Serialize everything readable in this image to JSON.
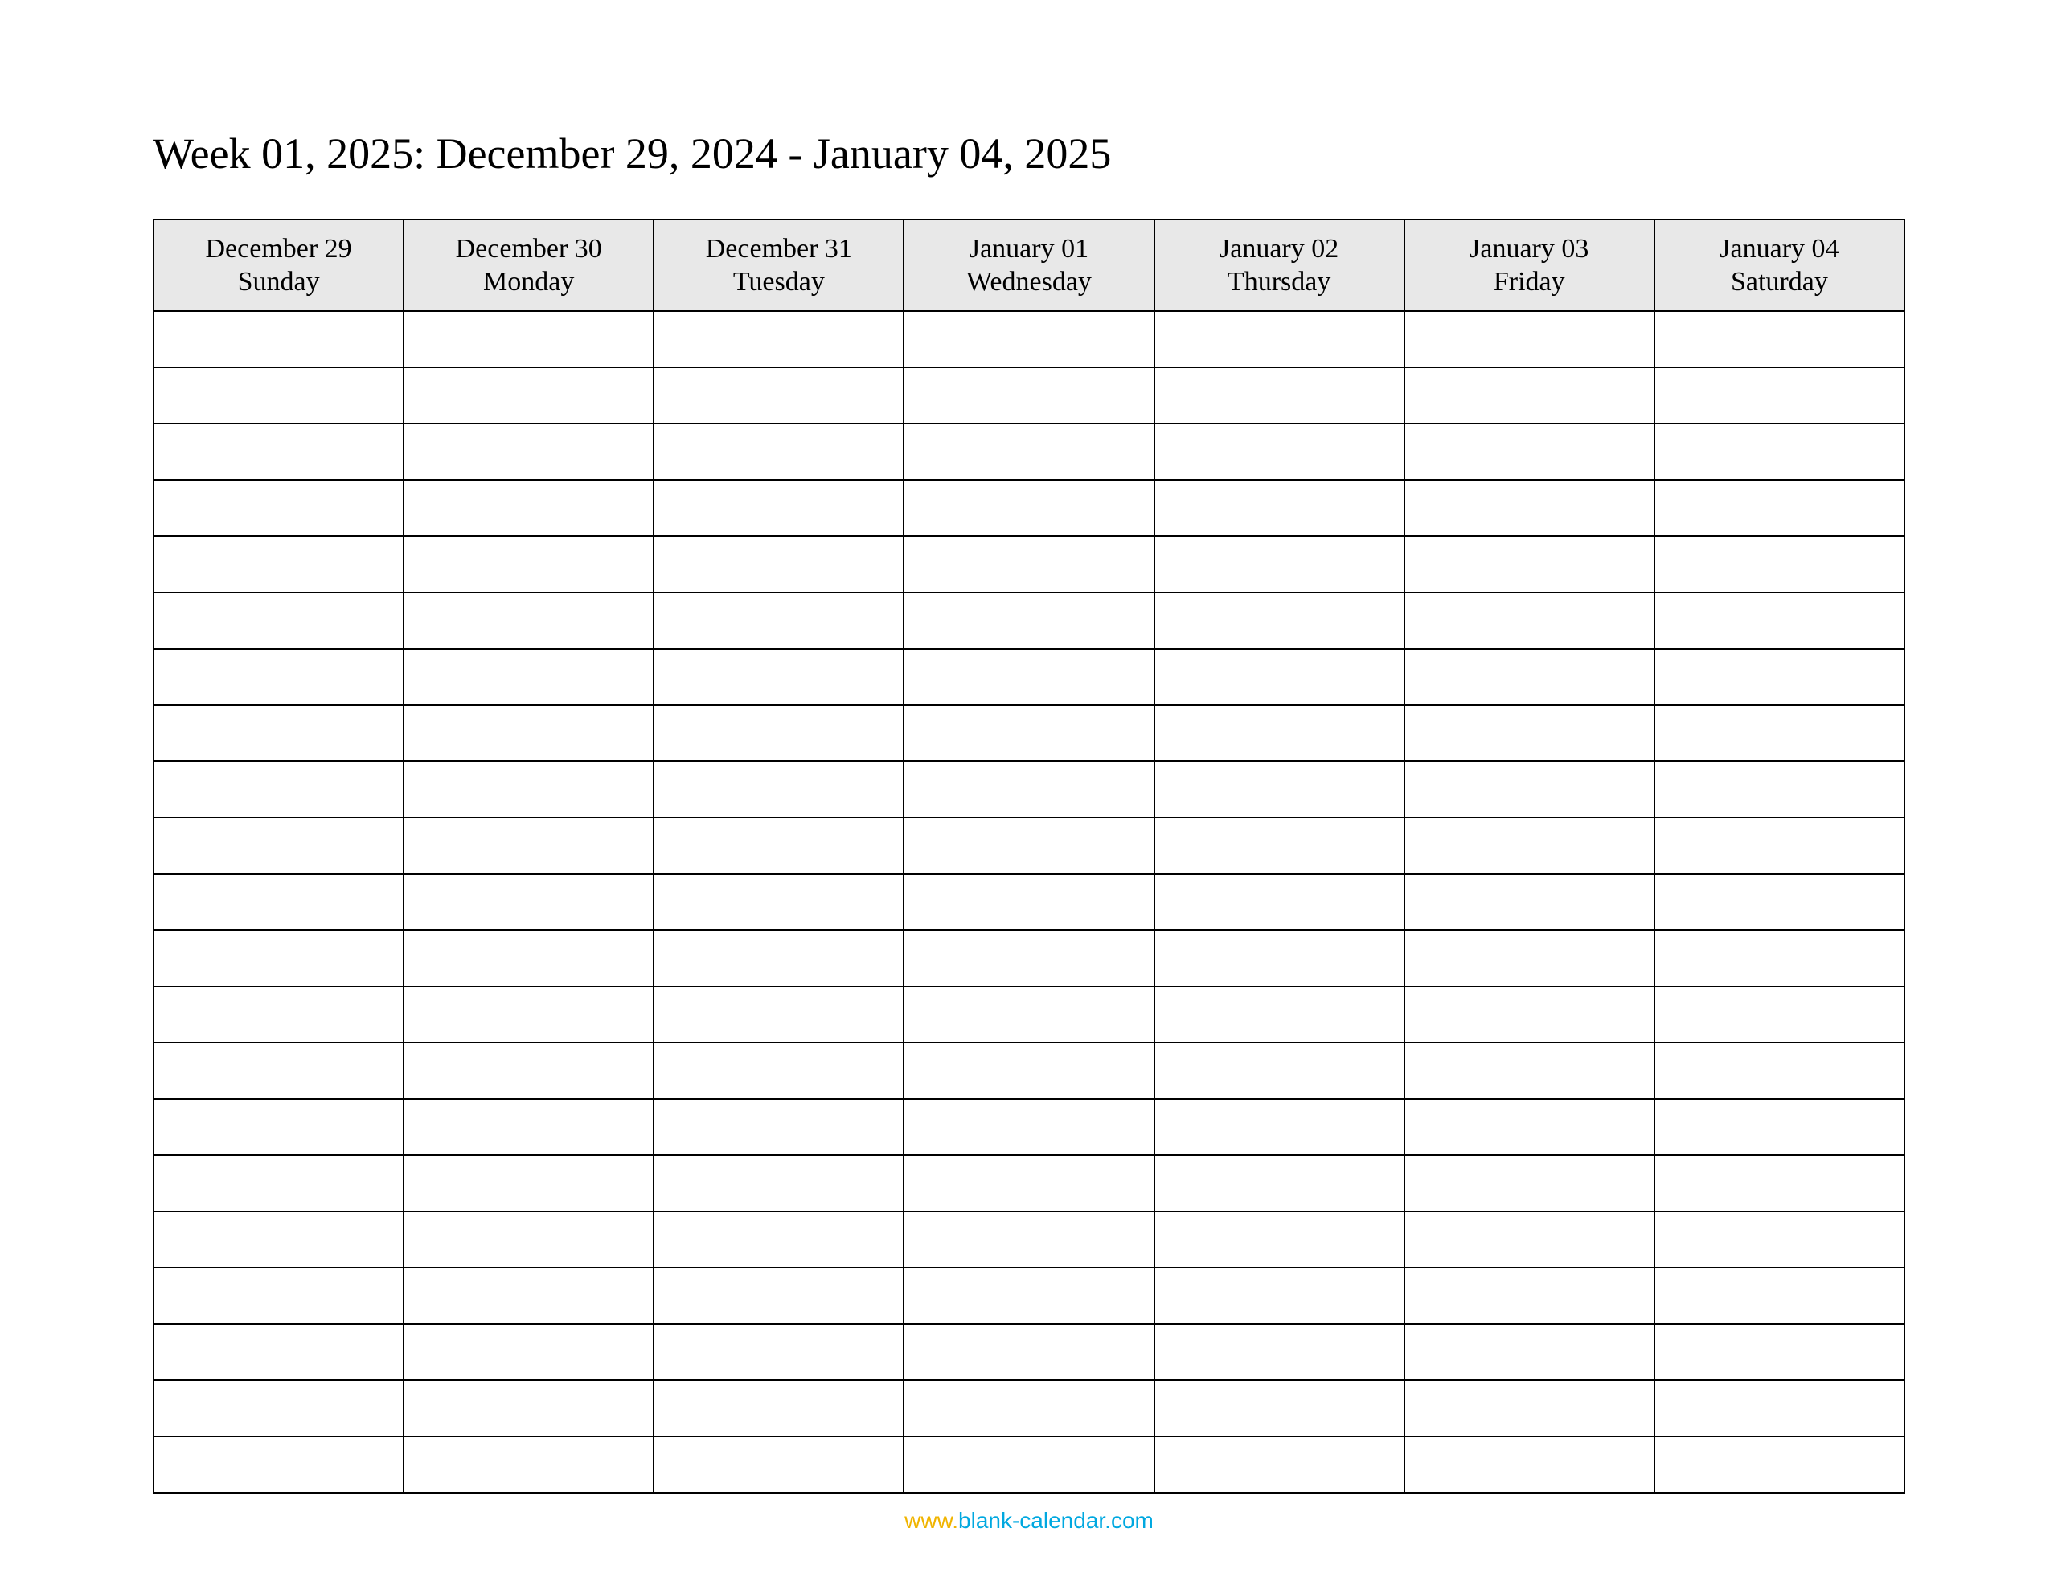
{
  "title": "Week 01, 2025: December 29, 2024 - January 04, 2025",
  "columns": [
    {
      "date": "December 29",
      "weekday": "Sunday"
    },
    {
      "date": "December 30",
      "weekday": "Monday"
    },
    {
      "date": "December 31",
      "weekday": "Tuesday"
    },
    {
      "date": "January 01",
      "weekday": "Wednesday"
    },
    {
      "date": "January 02",
      "weekday": "Thursday"
    },
    {
      "date": "January 03",
      "weekday": "Friday"
    },
    {
      "date": "January 04",
      "weekday": "Saturday"
    }
  ],
  "body_row_count": 21,
  "footer": {
    "prefix": "www.",
    "domain": "blank-calendar.com"
  }
}
